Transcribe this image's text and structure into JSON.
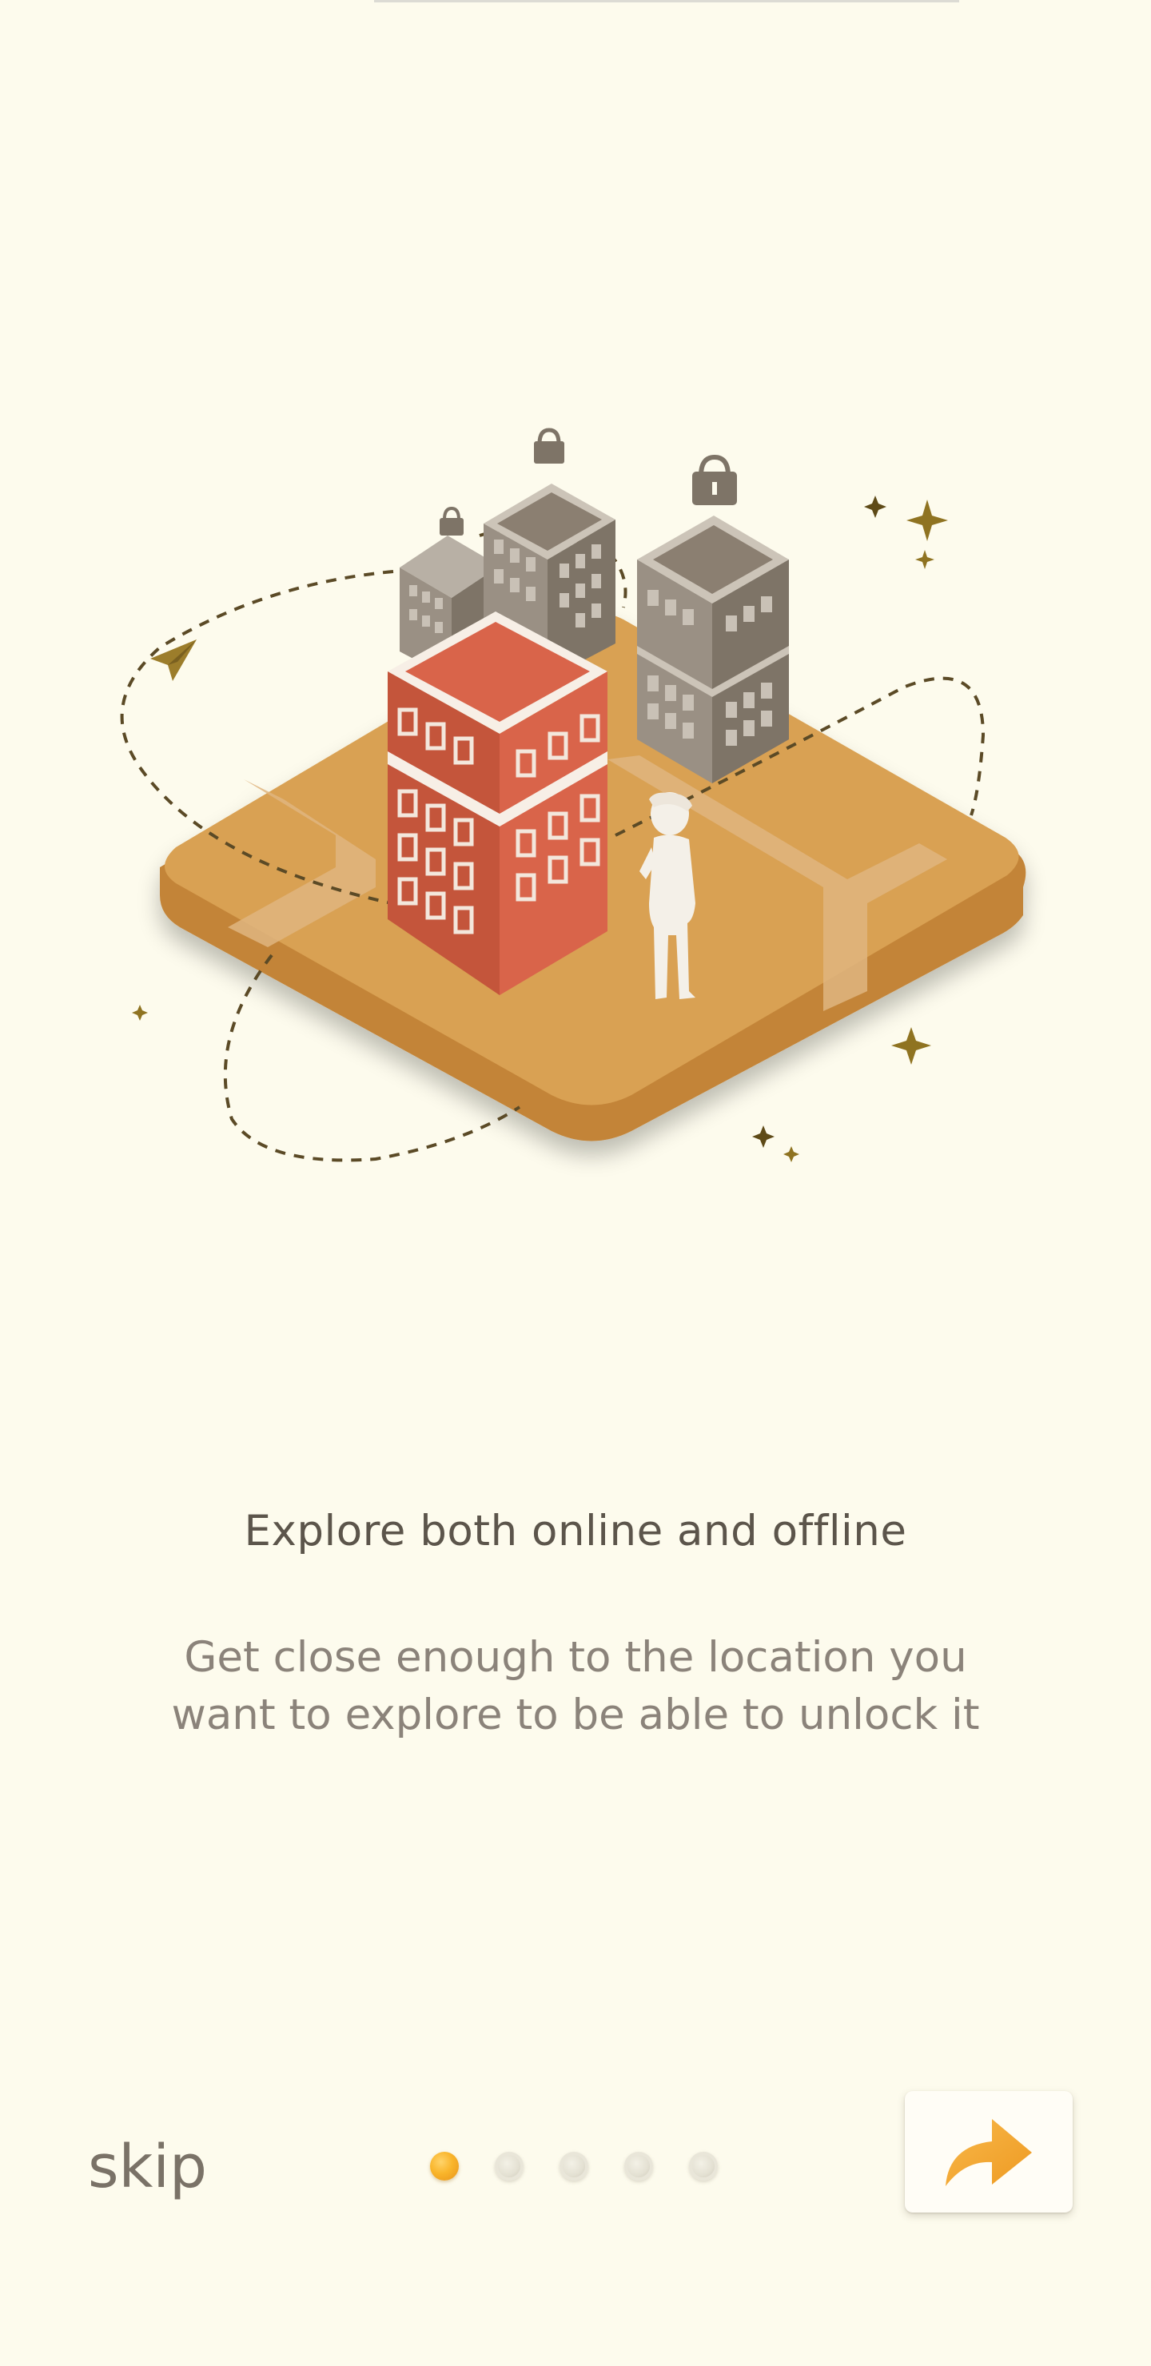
{
  "onboarding": {
    "title": "Explore both online and offline",
    "description": "Get close enough to the location you want to explore to be able to unlock it",
    "skip_label": "skip",
    "total_pages": 5,
    "current_page": 1,
    "next_icon": "forward-arrow-icon"
  },
  "colors": {
    "background": "#fdfbed",
    "accent": "#f5a623",
    "title_text": "#5c554b",
    "body_text": "#8b837a",
    "red_building": "#d9644a",
    "grey_building": "#8c8070",
    "ground": "#d9a153"
  }
}
